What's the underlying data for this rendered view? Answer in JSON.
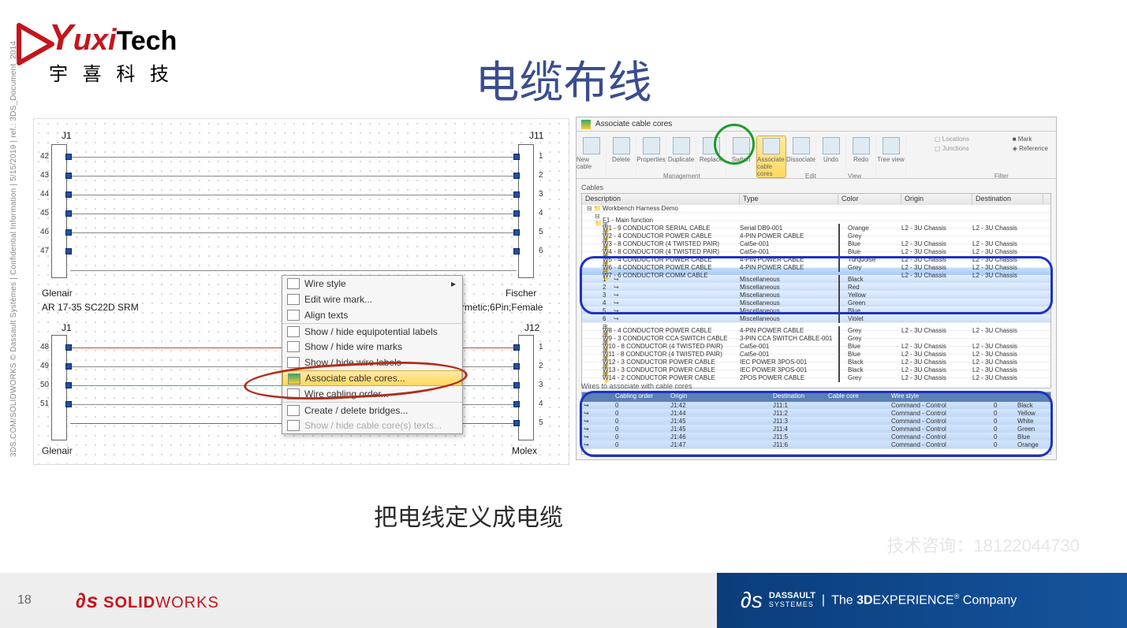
{
  "logo": {
    "name": "YuxiTech",
    "sub": "宇 喜 科 技"
  },
  "title": "电缆布线",
  "subtitle": "把电线定义成电缆",
  "copyright": "3DS.COM/SOLIDWORKS © Dassault Systèmes | Confidential Information | 5/15/2019 | ref.: 3DS_Document_2014",
  "watermark": "技术咨询：18122044730",
  "footer": {
    "page": "18",
    "sw": "SOLIDWORKS",
    "dsbrand": "DASSAULT",
    "dssys": "SYSTEMES",
    "exp": "The 3DEXPERIENCE® Company"
  },
  "schematic": {
    "j1": "J1",
    "j11": "J11",
    "j12": "J12",
    "j1b": "J1",
    "mfr1": "Glenair",
    "mfr2": "Fischer",
    "mfr3": "Glenair",
    "mfr4": "Molex",
    "part1": "AR 17-35 SC22D SRM",
    "part2": "nt; Hermetic;6Pin;Female",
    "pinsL": [
      "42",
      "43",
      "44",
      "45",
      "46",
      "47"
    ],
    "pinsR": [
      "1",
      "2",
      "3",
      "4",
      "5",
      "6"
    ],
    "pinsL2": [
      "48",
      "49",
      "50",
      "51"
    ],
    "pinsR2": [
      "1",
      "2",
      "3",
      "4",
      "5"
    ]
  },
  "context_menu": {
    "items": [
      {
        "label": "Wire style",
        "arrow": true
      },
      {
        "label": "Edit wire mark..."
      },
      {
        "label": "Align texts"
      },
      {
        "label": "Show / hide equipotential labels"
      },
      {
        "label": "Show / hide wire marks"
      },
      {
        "label": "Show / hide wire labels"
      },
      {
        "label": "Associate cable cores...",
        "highlight": true
      },
      {
        "label": "Wire cabling order..."
      },
      {
        "label": "Create / delete bridges..."
      },
      {
        "label": "Show / hide cable core(s) texts...",
        "disabled": true
      }
    ]
  },
  "dialog": {
    "title": "Associate cable cores",
    "ribbon": [
      {
        "label": "New cable"
      },
      {
        "label": "Delete"
      },
      {
        "label": "Properties"
      },
      {
        "label": "Duplicate"
      },
      {
        "label": "Replace"
      },
      {
        "label": "Switch"
      },
      {
        "label": "Associate cable cores",
        "highlight": true
      },
      {
        "label": "Dissociate"
      },
      {
        "label": "Undo"
      },
      {
        "label": "Redo"
      },
      {
        "label": "Tree view"
      }
    ],
    "ribbon_side": [
      "Mark",
      "Reference",
      "Locations",
      "Junctions"
    ],
    "ribbon_groups": [
      "Management",
      "Edit",
      "View",
      "Filter"
    ],
    "cables_group": "Cables",
    "headers": [
      "Description",
      "Type",
      "Color",
      "Origin",
      "Destination"
    ],
    "root": "Workbench Harness Demo",
    "root2": "F1 - Main function",
    "rows": [
      {
        "d": "W1 - 9 CONDUCTOR SERIAL CABLE",
        "t": "Serial DB9-001",
        "c": "Orange",
        "sw": "#e08820",
        "o": "L2 - 3U Chassis",
        "x": "L2 - 3U Chassis"
      },
      {
        "d": "W2 - 4 CONDUCTOR POWER CABLE",
        "t": "4-PIN POWER CABLE",
        "c": "Grey",
        "sw": "#888",
        "o": "",
        "x": ""
      },
      {
        "d": "W3 - 8 CONDUCTOR (4 TWISTED PAIR)",
        "t": "Cat5e-001",
        "c": "Blue",
        "sw": "#2d5db4",
        "o": "L2 - 3U Chassis",
        "x": "L2 - 3U Chassis"
      },
      {
        "d": "W4 - 8 CONDUCTOR (4 TWISTED PAIR)",
        "t": "Cat5e-001",
        "c": "Blue",
        "sw": "#2d5db4",
        "o": "L2 - 3U Chassis",
        "x": "L2 - 3U Chassis"
      },
      {
        "d": "W5 - 4 CONDUCTOR POWER CABLE",
        "t": "4-PIN POWER CABLE",
        "c": "Turquoise",
        "sw": "#30b5b5",
        "o": "L2 - 3U Chassis",
        "x": "L2 - 3U Chassis"
      },
      {
        "d": "W6 - 4 CONDUCTOR POWER CABLE",
        "t": "4-PIN POWER CABLE",
        "c": "Grey",
        "sw": "#888",
        "o": "L2 - 3U Chassis",
        "x": "L2 - 3U Chassis"
      }
    ],
    "cores": [
      {
        "n": "1",
        "t": "Miscellaneous",
        "c": "Black",
        "sw": "#111"
      },
      {
        "n": "2",
        "t": "Miscellaneous",
        "c": "Red",
        "sw": "#c22"
      },
      {
        "n": "3",
        "t": "Miscellaneous",
        "c": "Yellow",
        "sw": "#e8d23a"
      },
      {
        "n": "4",
        "t": "Miscellaneous",
        "c": "Green",
        "sw": "#2a8a2a"
      },
      {
        "n": "5",
        "t": "Miscellaneous",
        "c": "Blue",
        "sw": "#2d5db4"
      },
      {
        "n": "6",
        "t": "Miscellaneous",
        "c": "Violet",
        "sw": "#7a3aa8"
      }
    ],
    "rows2": [
      {
        "d": "W8 - 4 CONDUCTOR POWER CABLE",
        "t": "4-PIN POWER CABLE",
        "c": "Grey",
        "sw": "#888",
        "o": "L2 - 3U Chassis",
        "x": "L2 - 3U Chassis"
      },
      {
        "d": "W9 - 3 CONDUCTOR CCA SWITCH CABLE",
        "t": "3-PIN CCA SWITCH CABLE-001",
        "c": "Grey",
        "sw": "#888",
        "o": "",
        "x": ""
      },
      {
        "d": "W10 - 8 CONDUCTOR (4 TWISTED PAIR)",
        "t": "Cat5e-001",
        "c": "Blue",
        "sw": "#2d5db4",
        "o": "L2 - 3U Chassis",
        "x": "L2 - 3U Chassis"
      },
      {
        "d": "W11 - 8 CONDUCTOR (4 TWISTED PAIR)",
        "t": "Cat5e-001",
        "c": "Blue",
        "sw": "#2d5db4",
        "o": "L2 - 3U Chassis",
        "x": "L2 - 3U Chassis"
      },
      {
        "d": "W12 - 3 CONDUCTOR POWER CABLE",
        "t": "IEC POWER 3POS-001",
        "c": "Black",
        "sw": "#111",
        "o": "L2 - 3U Chassis",
        "x": "L2 - 3U Chassis"
      },
      {
        "d": "W13 - 3 CONDUCTOR POWER CABLE",
        "t": "IEC POWER 3POS-001",
        "c": "Black",
        "sw": "#111",
        "o": "L2 - 3U Chassis",
        "x": "L2 - 3U Chassis"
      },
      {
        "d": "W14 - 2 CONDUCTOR POWER CABLE",
        "t": "2POS POWER CABLE",
        "c": "Grey",
        "sw": "#888",
        "o": "L2 - 3U Chassis",
        "x": "L2 - 3U Chassis"
      }
    ],
    "assoc_title": "Wires to associate with cable cores",
    "assoc_headers": [
      "",
      "Cabling order",
      "Origin",
      "",
      "Destination",
      "Cable core",
      "Wire style",
      "",
      ""
    ],
    "assoc": [
      {
        "o": "0",
        "a": "J1:42",
        "b": "J11:1",
        "s": "Command - Control",
        "n": "0",
        "c": "Black"
      },
      {
        "o": "0",
        "a": "J1:44",
        "b": "J11:2",
        "s": "Command - Control",
        "n": "0",
        "c": "Yellow"
      },
      {
        "o": "0",
        "a": "J1:45",
        "b": "J11:3",
        "s": "Command - Control",
        "n": "0",
        "c": "White"
      },
      {
        "o": "0",
        "a": "J1:45",
        "b": "J11:4",
        "s": "Command - Control",
        "n": "0",
        "c": "Green"
      },
      {
        "o": "0",
        "a": "J1:46",
        "b": "J11:5",
        "s": "Command - Control",
        "n": "0",
        "c": "Blue"
      },
      {
        "o": "0",
        "a": "J1:47",
        "b": "J11:6",
        "s": "Command - Control",
        "n": "0",
        "c": "Orange"
      }
    ]
  }
}
